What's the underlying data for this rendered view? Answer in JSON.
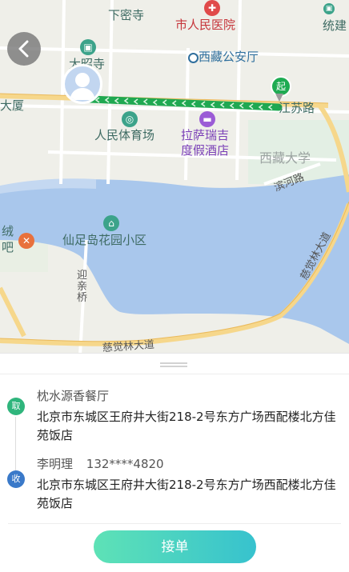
{
  "colors": {
    "accent": "#41d3bf",
    "pickup_badge": "#2fb57c",
    "dropoff_badge": "#3a79c9",
    "route": "#1fa851",
    "water": "#a9c7ec",
    "road": "#f6d78b"
  },
  "map": {
    "labels": {
      "xiamisi": "下密寺",
      "hospital": "市人民医院",
      "tongjian": "统建",
      "dazhaosi": "大昭寺",
      "police": "西藏公安厅",
      "dasha": "大厦",
      "jiangsu_road": "江苏路",
      "stadium": "人民体育场",
      "hotel_line1": "拉萨瑞吉",
      "hotel_line2": "度假酒店",
      "university": "西藏大学",
      "binhe_road": "滨河路",
      "xianzudao": "仙足岛花园小区",
      "left_line1": "绒",
      "left_line2": "吧",
      "yingqin_bridge": "迎亲桥",
      "ciju_avenue_bottom": "慈觉林大道",
      "ciju_avenue_right": "慈觉林大道"
    },
    "markers": {
      "start": "起"
    },
    "icons": {
      "back": "chevron-left-icon",
      "hospital": "hospital-icon",
      "bus": "bus-icon",
      "stadium": "stadium-icon",
      "hotel": "hotel-icon",
      "restaurant": "restaurant-icon",
      "school": "school-icon",
      "avatar": "user-avatar-icon"
    }
  },
  "order": {
    "pickup": {
      "badge": "取",
      "name": "枕水源香餐厅",
      "address": "北京市东城区王府井大街218-2号东方广场西配楼北方佳苑饭店"
    },
    "dropoff": {
      "badge": "收",
      "name": "李明理",
      "phone": "132****4820",
      "address": "北京市东城区王府井大街218-2号东方广场西配楼北方佳苑饭店"
    },
    "accept_label": "接单"
  }
}
